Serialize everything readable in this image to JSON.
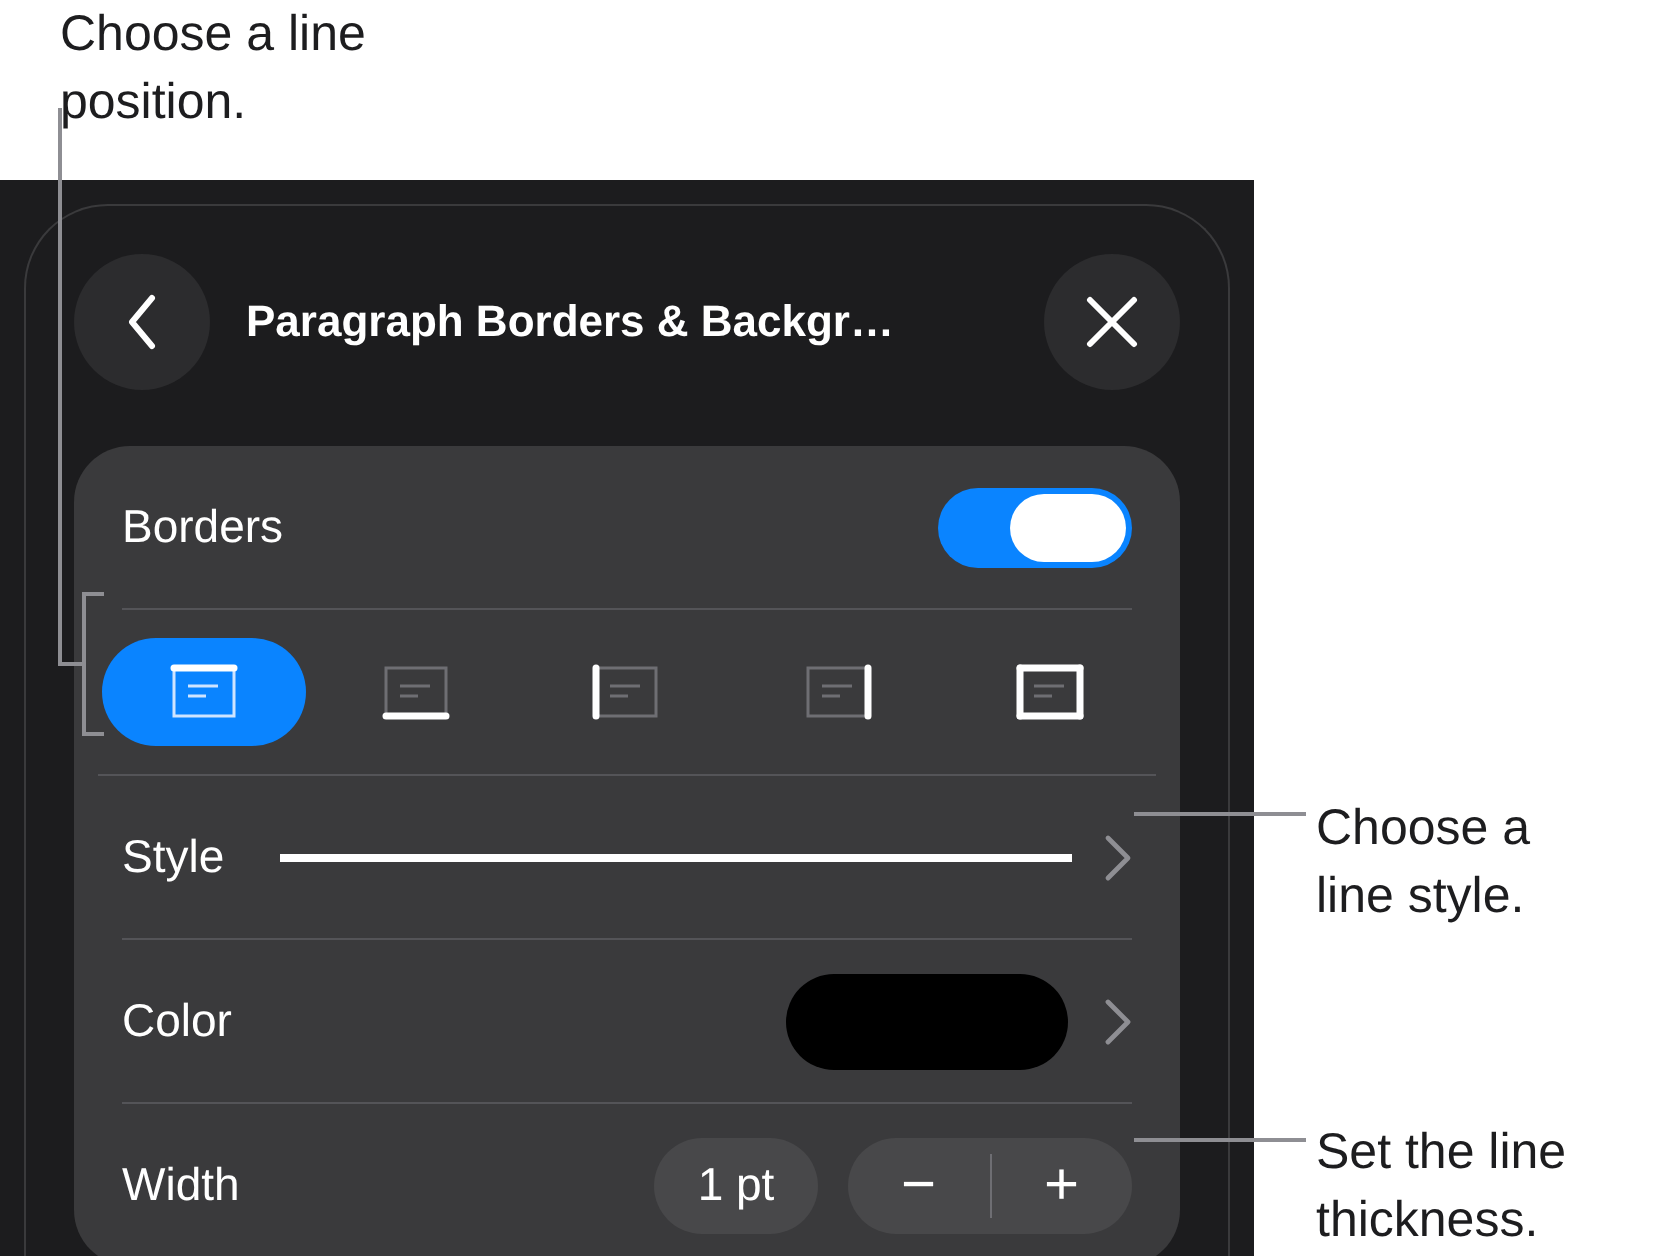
{
  "callouts": [
    {
      "text": "Choose a line position.",
      "kind": "left"
    },
    {
      "text": "Choose a line style.",
      "kind": "style"
    },
    {
      "text": "Set the line thickness.",
      "kind": "width"
    }
  ],
  "header": {
    "title": "Paragraph Borders & Backgr…"
  },
  "borders": {
    "label": "Borders",
    "on": true
  },
  "positions": [
    {
      "kind": "top",
      "selected": true
    },
    {
      "kind": "bottom",
      "selected": false
    },
    {
      "kind": "left",
      "selected": false
    },
    {
      "kind": "right",
      "selected": false
    },
    {
      "kind": "all",
      "selected": false
    }
  ],
  "style": {
    "label": "Style"
  },
  "color": {
    "label": "Color"
  },
  "width": {
    "label": "Width",
    "value": "1 pt",
    "minus": "−",
    "plus": "+"
  }
}
